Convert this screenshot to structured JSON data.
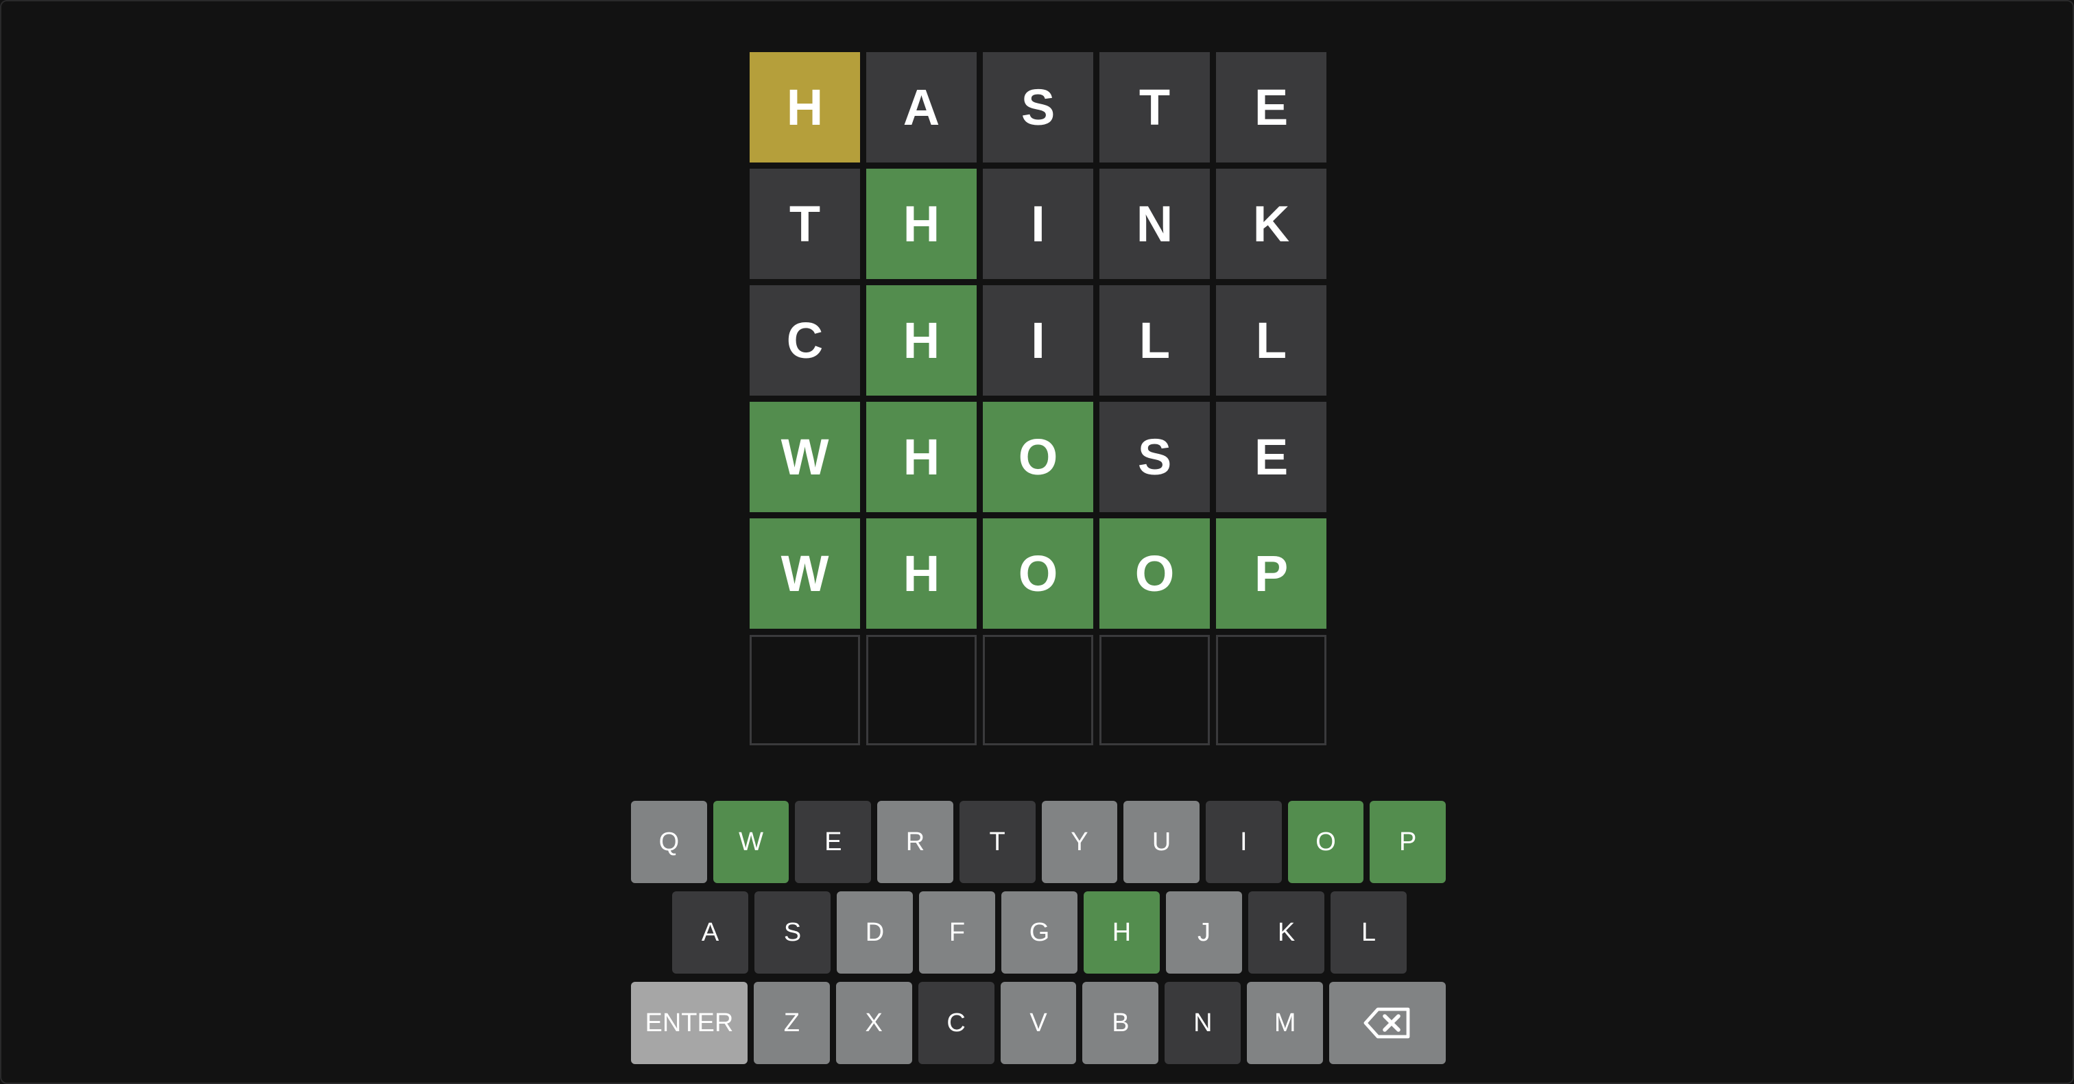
{
  "colors": {
    "background": "#121212",
    "correct": "#538d4e",
    "present": "#b59f3b",
    "absent": "#3a3a3c",
    "unused": "#818384",
    "enter_key": "#a6a6a6",
    "empty_border": "#3a3a3c"
  },
  "board": {
    "rows": [
      {
        "tiles": [
          {
            "letter": "H",
            "state": "present"
          },
          {
            "letter": "A",
            "state": "absent"
          },
          {
            "letter": "S",
            "state": "absent"
          },
          {
            "letter": "T",
            "state": "absent"
          },
          {
            "letter": "E",
            "state": "absent"
          }
        ]
      },
      {
        "tiles": [
          {
            "letter": "T",
            "state": "absent"
          },
          {
            "letter": "H",
            "state": "correct"
          },
          {
            "letter": "I",
            "state": "absent"
          },
          {
            "letter": "N",
            "state": "absent"
          },
          {
            "letter": "K",
            "state": "absent"
          }
        ]
      },
      {
        "tiles": [
          {
            "letter": "C",
            "state": "absent"
          },
          {
            "letter": "H",
            "state": "correct"
          },
          {
            "letter": "I",
            "state": "absent"
          },
          {
            "letter": "L",
            "state": "absent"
          },
          {
            "letter": "L",
            "state": "absent"
          }
        ]
      },
      {
        "tiles": [
          {
            "letter": "W",
            "state": "correct"
          },
          {
            "letter": "H",
            "state": "correct"
          },
          {
            "letter": "O",
            "state": "correct"
          },
          {
            "letter": "S",
            "state": "absent"
          },
          {
            "letter": "E",
            "state": "absent"
          }
        ]
      },
      {
        "tiles": [
          {
            "letter": "W",
            "state": "correct"
          },
          {
            "letter": "H",
            "state": "correct"
          },
          {
            "letter": "O",
            "state": "correct"
          },
          {
            "letter": "O",
            "state": "correct"
          },
          {
            "letter": "P",
            "state": "correct"
          }
        ]
      },
      {
        "tiles": [
          {
            "letter": "",
            "state": "empty"
          },
          {
            "letter": "",
            "state": "empty"
          },
          {
            "letter": "",
            "state": "empty"
          },
          {
            "letter": "",
            "state": "empty"
          },
          {
            "letter": "",
            "state": "empty"
          }
        ]
      }
    ]
  },
  "keyboard": {
    "rows": [
      [
        {
          "label": "Q",
          "state": "unused"
        },
        {
          "label": "W",
          "state": "correct"
        },
        {
          "label": "E",
          "state": "absent"
        },
        {
          "label": "R",
          "state": "unused"
        },
        {
          "label": "T",
          "state": "absent"
        },
        {
          "label": "Y",
          "state": "unused"
        },
        {
          "label": "U",
          "state": "unused"
        },
        {
          "label": "I",
          "state": "absent"
        },
        {
          "label": "O",
          "state": "correct"
        },
        {
          "label": "P",
          "state": "correct"
        }
      ],
      [
        {
          "label": "A",
          "state": "absent"
        },
        {
          "label": "S",
          "state": "absent"
        },
        {
          "label": "D",
          "state": "unused"
        },
        {
          "label": "F",
          "state": "unused"
        },
        {
          "label": "G",
          "state": "unused"
        },
        {
          "label": "H",
          "state": "correct"
        },
        {
          "label": "J",
          "state": "unused"
        },
        {
          "label": "K",
          "state": "absent"
        },
        {
          "label": "L",
          "state": "absent"
        }
      ],
      [
        {
          "label": "ENTER",
          "state": "enter"
        },
        {
          "label": "Z",
          "state": "unused"
        },
        {
          "label": "X",
          "state": "unused"
        },
        {
          "label": "C",
          "state": "absent"
        },
        {
          "label": "V",
          "state": "unused"
        },
        {
          "label": "B",
          "state": "unused"
        },
        {
          "label": "N",
          "state": "absent"
        },
        {
          "label": "M",
          "state": "unused"
        },
        {
          "label": "",
          "state": "backspace",
          "icon": "backspace-icon"
        }
      ]
    ]
  }
}
